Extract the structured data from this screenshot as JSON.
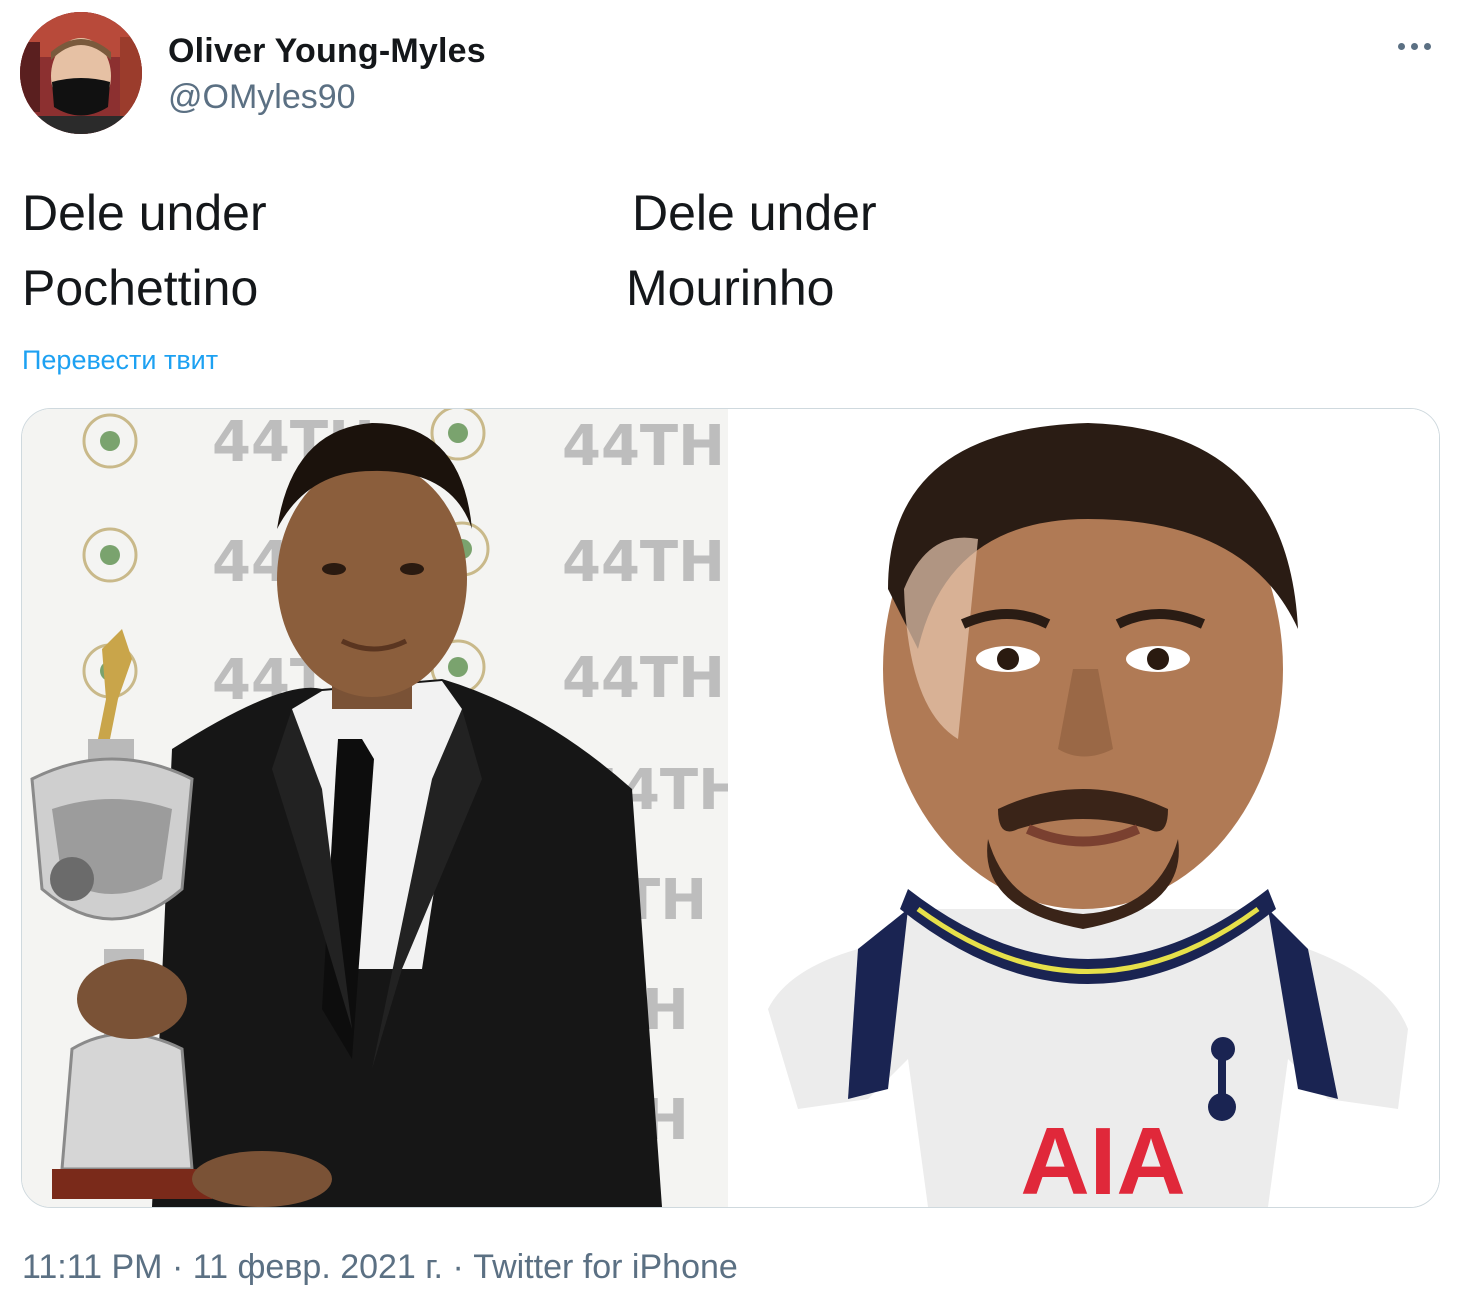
{
  "tweet": {
    "author": {
      "name": "Oliver Young-Myles",
      "handle": "@OMyles90",
      "avatar_icon": "profile-photo-masked-man"
    },
    "more_icon": "more-dots-icon",
    "text": {
      "left_line1": "Dele under",
      "left_line2": "Pochettino",
      "right_line1": "Dele under",
      "right_line2": "Mourinho"
    },
    "translate_label": "Перевести твит",
    "media": {
      "left_image": "photo-player-in-suit-holding-trophy",
      "right_image": "photo-stuffed-player-doll-in-white-kit",
      "backdrop_text": "44TH",
      "sponsor_text": "AIA"
    },
    "meta": {
      "time": "11:11 PM",
      "separator": "·",
      "date": "11 февр. 2021 г.",
      "source": "Twitter for iPhone"
    }
  },
  "colors": {
    "text_primary": "#14171a",
    "text_secondary": "#5b7083",
    "link": "#1da1f2",
    "border": "#cfd9de",
    "sponsor_red": "#e0283a",
    "kit_navy": "#1a2452"
  }
}
